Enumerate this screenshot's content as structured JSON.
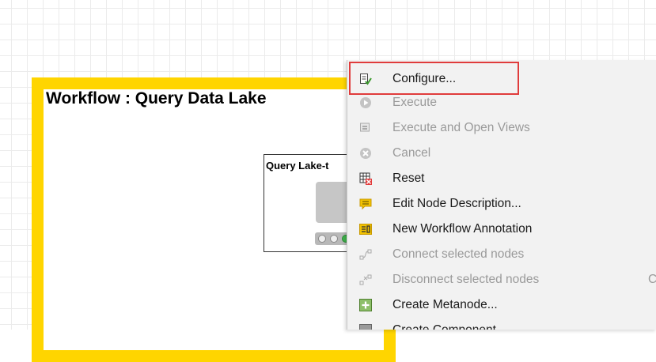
{
  "workflow": {
    "title": "Workflow : Query Data Lake",
    "node_label": "Query Lake-t"
  },
  "context_menu": {
    "items": [
      {
        "label": "Configure...",
        "icon": "configure-icon",
        "enabled": true,
        "highlighted": true
      },
      {
        "label": "Execute",
        "icon": "execute-icon",
        "enabled": false
      },
      {
        "label": "Execute and Open Views",
        "icon": "execute-open-views-icon",
        "enabled": false
      },
      {
        "label": "Cancel",
        "icon": "cancel-icon",
        "enabled": false
      },
      {
        "label": "Reset",
        "icon": "reset-icon",
        "enabled": true
      },
      {
        "label": "Edit Node Description...",
        "icon": "edit-description-icon",
        "enabled": true
      },
      {
        "label": "New Workflow Annotation",
        "icon": "annotation-icon",
        "enabled": true
      },
      {
        "label": "Connect selected nodes",
        "icon": "connect-nodes-icon",
        "enabled": false
      },
      {
        "label": "Disconnect selected nodes",
        "icon": "disconnect-nodes-icon",
        "enabled": false,
        "shortcut": "C"
      },
      {
        "label": "Create Metanode...",
        "icon": "create-metanode-icon",
        "enabled": true
      },
      {
        "label": "Create Component...",
        "icon": "create-component-icon",
        "enabled": true
      }
    ]
  },
  "colors": {
    "annotation_border": "#ffd500",
    "highlight": "#e03c3c",
    "status_green": "#3fb24b"
  }
}
